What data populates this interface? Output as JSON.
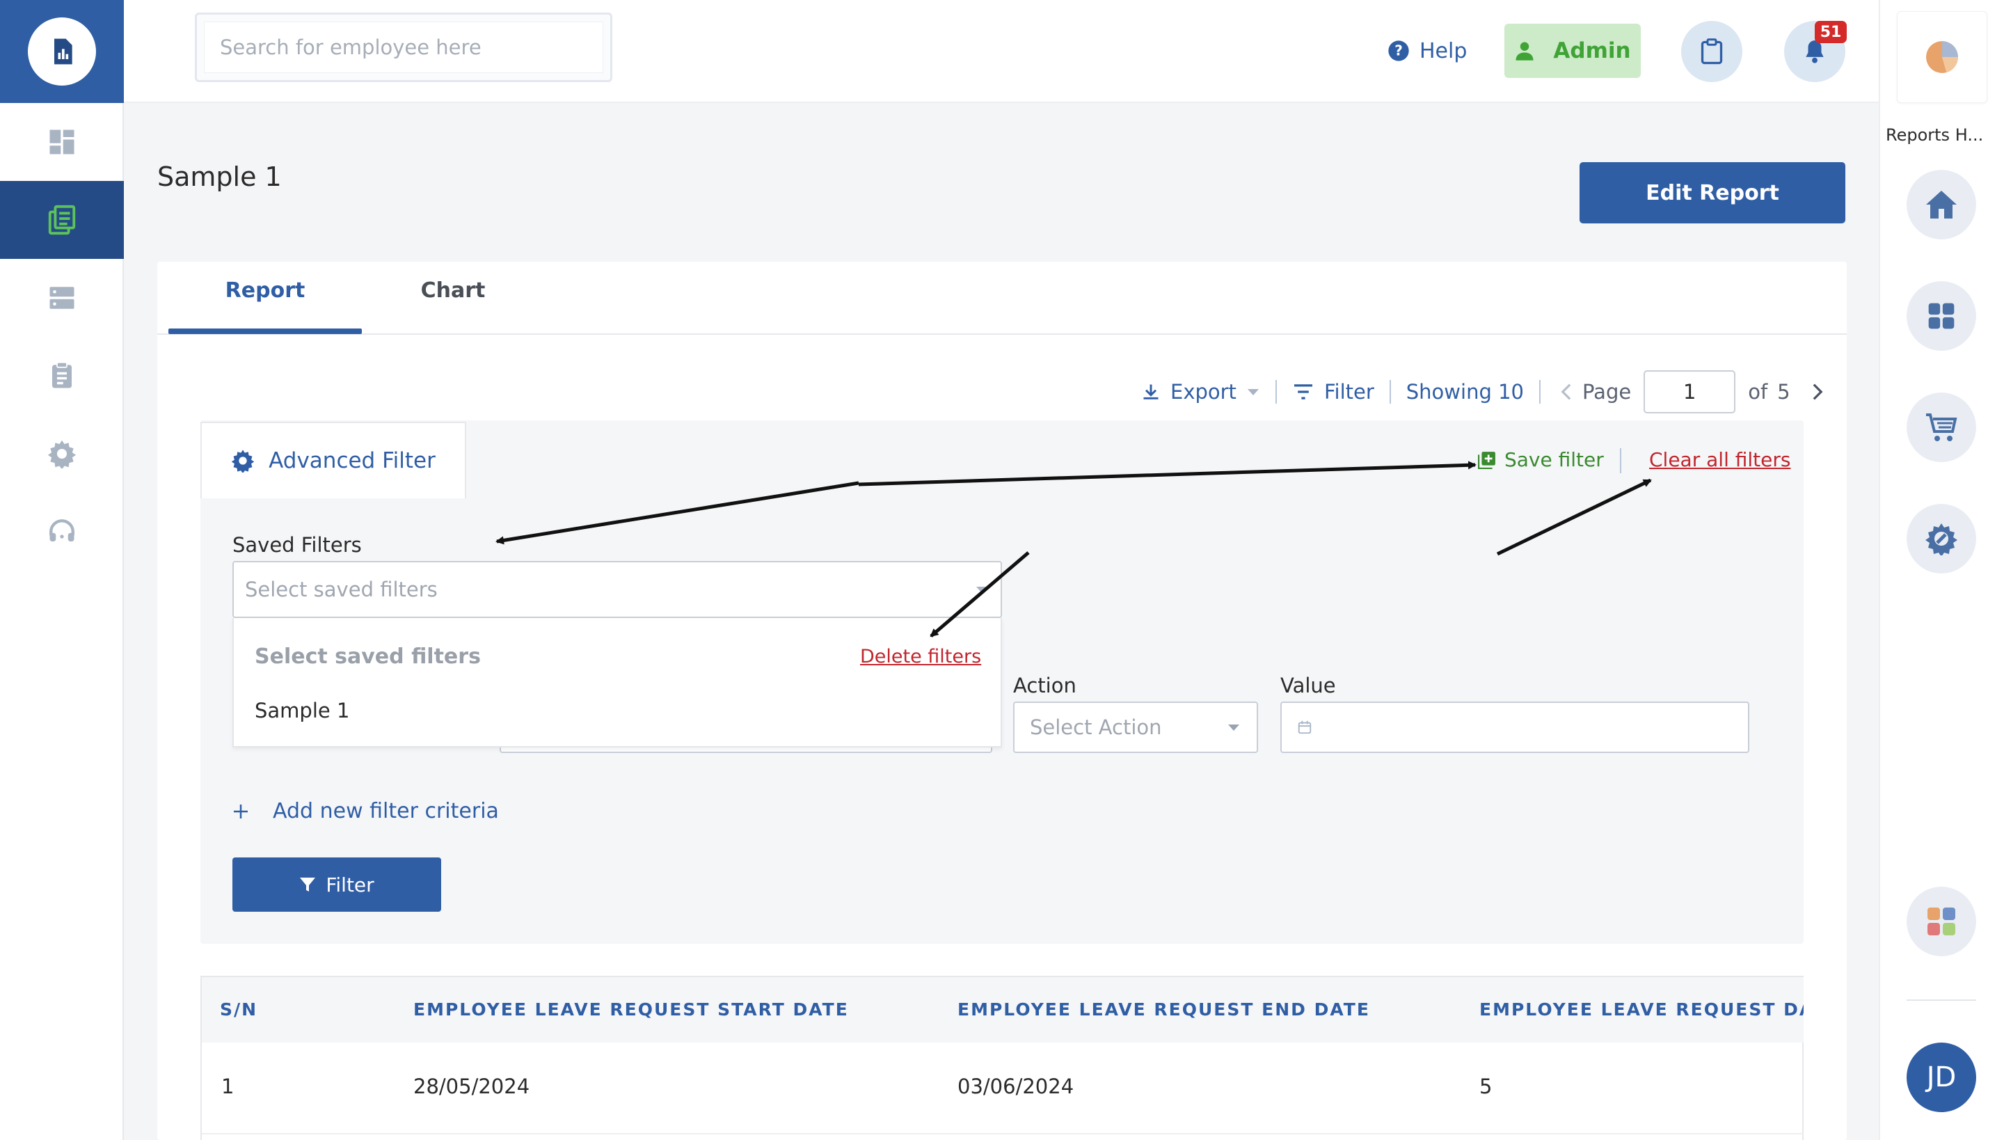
{
  "search": {
    "placeholder": "Search for employee here"
  },
  "header": {
    "help_label": "Help",
    "admin_label": "Admin",
    "notification_count": "51"
  },
  "right_rail": {
    "label": "Reports H..."
  },
  "user": {
    "initials": "JD"
  },
  "page": {
    "title": "Sample 1",
    "edit_button": "Edit Report"
  },
  "tabs": [
    {
      "label": "Report",
      "active": true
    },
    {
      "label": "Chart",
      "active": false
    }
  ],
  "toolbar": {
    "export_label": "Export",
    "filter_label": "Filter",
    "showing_label": "Showing 10",
    "page_label": "Page",
    "page_value": "1",
    "of_label": "of",
    "total_pages": "5"
  },
  "advanced_filter": {
    "tab_label": "Advanced Filter",
    "save_filter": "Save filter",
    "clear_all": "Clear all filters",
    "saved_filters_label": "Saved Filters",
    "saved_filters_placeholder": "Select saved filters",
    "dropdown_header": "Select saved filters",
    "delete_filters": "Delete filters",
    "saved_options": [
      "Sample 1"
    ],
    "action_label": "Action",
    "action_placeholder": "Select Action",
    "value_label": "Value",
    "add_criteria": "Add new filter criteria",
    "filter_button": "Filter"
  },
  "table": {
    "columns": [
      "S/N",
      "EMPLOYEE LEAVE REQUEST START DATE",
      "EMPLOYEE LEAVE REQUEST END DATE",
      "EMPLOYEE LEAVE REQUEST DAYS"
    ],
    "rows": [
      [
        "1",
        "28/05/2024",
        "03/06/2024",
        "5"
      ]
    ]
  },
  "colors": {
    "primary": "#2f5ea5",
    "sidebar_active": "#244b85",
    "success": "#3fa336",
    "danger": "#c0262d"
  },
  "icons": {
    "logo": "report-chart-icon",
    "sidebar": [
      "dashboard-icon",
      "reports-icon",
      "server-icon",
      "clipboard-list-icon",
      "gear-icon",
      "headset-icon"
    ]
  }
}
